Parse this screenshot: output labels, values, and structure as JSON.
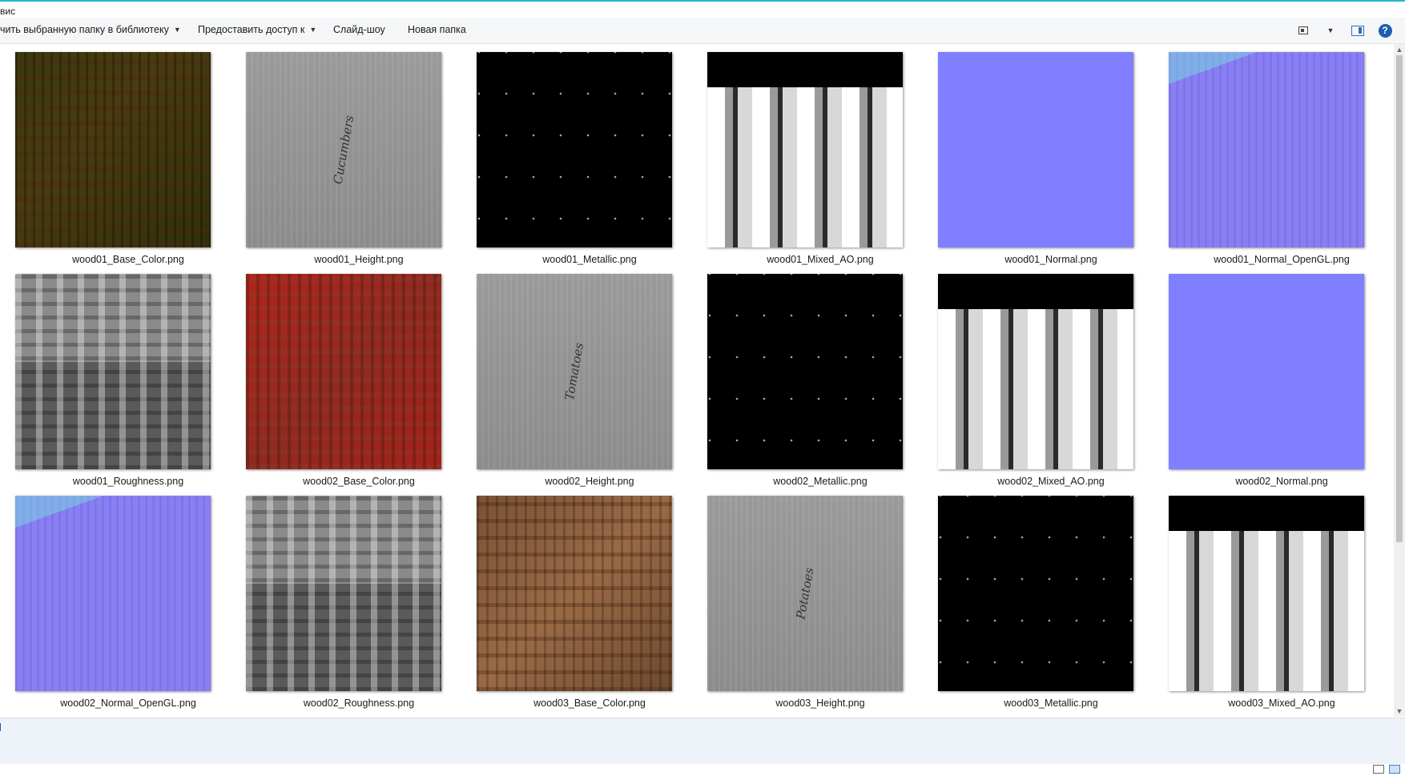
{
  "window": {
    "title_fragment": "вис"
  },
  "toolbar": {
    "include_in_library": "чить выбранную папку в библиотеку",
    "share_with": "Предоставить доступ к",
    "slideshow": "Слайд-шоу",
    "new_folder": "Новая папка"
  },
  "toolbar_right_icons": [
    "change-view-icon",
    "chevron-down-icon",
    "preview-pane-icon",
    "help-icon"
  ],
  "files": [
    {
      "name": "wood01_Base_Color.png",
      "look": "t-base1"
    },
    {
      "name": "wood01_Height.png",
      "look": "t-height",
      "word": "Cucumbers"
    },
    {
      "name": "wood01_Metallic.png",
      "look": "t-metal"
    },
    {
      "name": "wood01_Mixed_AO.png",
      "look": "t-ao"
    },
    {
      "name": "wood01_Normal.png",
      "look": "t-normal"
    },
    {
      "name": "wood01_Normal_OpenGL.png",
      "look": "t-normalgl"
    },
    {
      "name": "wood01_Roughness.png",
      "look": "t-rough"
    },
    {
      "name": "wood02_Base_Color.png",
      "look": "t-base2"
    },
    {
      "name": "wood02_Height.png",
      "look": "t-height",
      "word": "Tomatoes"
    },
    {
      "name": "wood02_Metallic.png",
      "look": "t-metal"
    },
    {
      "name": "wood02_Mixed_AO.png",
      "look": "t-ao"
    },
    {
      "name": "wood02_Normal.png",
      "look": "t-normal"
    },
    {
      "name": "wood02_Normal_OpenGL.png",
      "look": "t-normalgl"
    },
    {
      "name": "wood02_Roughness.png",
      "look": "t-rough"
    },
    {
      "name": "wood03_Base_Color.png",
      "look": "t-base3"
    },
    {
      "name": "wood03_Height.png",
      "look": "t-height",
      "word": "Potatoes"
    },
    {
      "name": "wood03_Metallic.png",
      "look": "t-metal"
    },
    {
      "name": "wood03_Mixed_AO.png",
      "look": "t-ao"
    }
  ],
  "colors": {
    "accent_top": "#25b6c7",
    "normal_map": "#7f7fff",
    "help_icon": "#1c5fb0"
  }
}
